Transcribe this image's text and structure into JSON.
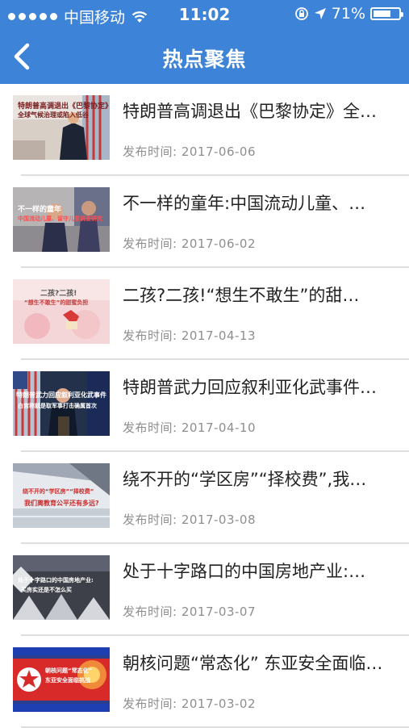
{
  "status_bar": {
    "carrier": "中国移动",
    "time": "11:02",
    "battery": "71%",
    "battery_level": 0.71
  },
  "nav": {
    "title": "热点聚焦"
  },
  "date_prefix": "发布时间:",
  "articles": [
    {
      "title": "特朗普高调退出《巴黎协定》全…",
      "date": "2017-06-06",
      "thumb_text": [
        "特朗普高调退出《巴黎协定》",
        "全球气候治理或陷入低谷"
      ]
    },
    {
      "title": "不一样的童年:中国流动儿童、…",
      "date": "2017-06-02",
      "thumb_text": [
        "不一样的童年",
        "中国流动儿童、留守儿童调查研究"
      ]
    },
    {
      "title": "二孩?二孩!“想生不敢生”的甜…",
      "date": "2017-04-13",
      "thumb_text": [
        "二孩?二孩!",
        "“想生不敢生”的甜蜜负担"
      ]
    },
    {
      "title": "特朗普武力回应叙利亚化武事件…",
      "date": "2017-04-10",
      "thumb_text": [
        "特朗普武力回应叙利亚化武事件",
        "白宫称就是取军事打击确属首次"
      ]
    },
    {
      "title": "绕不开的“学区房”“择校费”,我…",
      "date": "2017-03-08",
      "thumb_text": [
        "绕不开的“学区房”“择校费”",
        "我们离教育公平还有多远?"
      ]
    },
    {
      "title": "处于十字路口的中国房地产业:…",
      "date": "2017-03-07",
      "thumb_text": [
        "处于十字路口的中国房地产业:",
        "买房实还是不怎么买"
      ]
    },
    {
      "title": "朝核问题“常态化” 东亚安全面临…",
      "date": "2017-03-02",
      "thumb_text": [
        "朝核问题“常态化”",
        "东亚安全面临挑战"
      ]
    }
  ]
}
